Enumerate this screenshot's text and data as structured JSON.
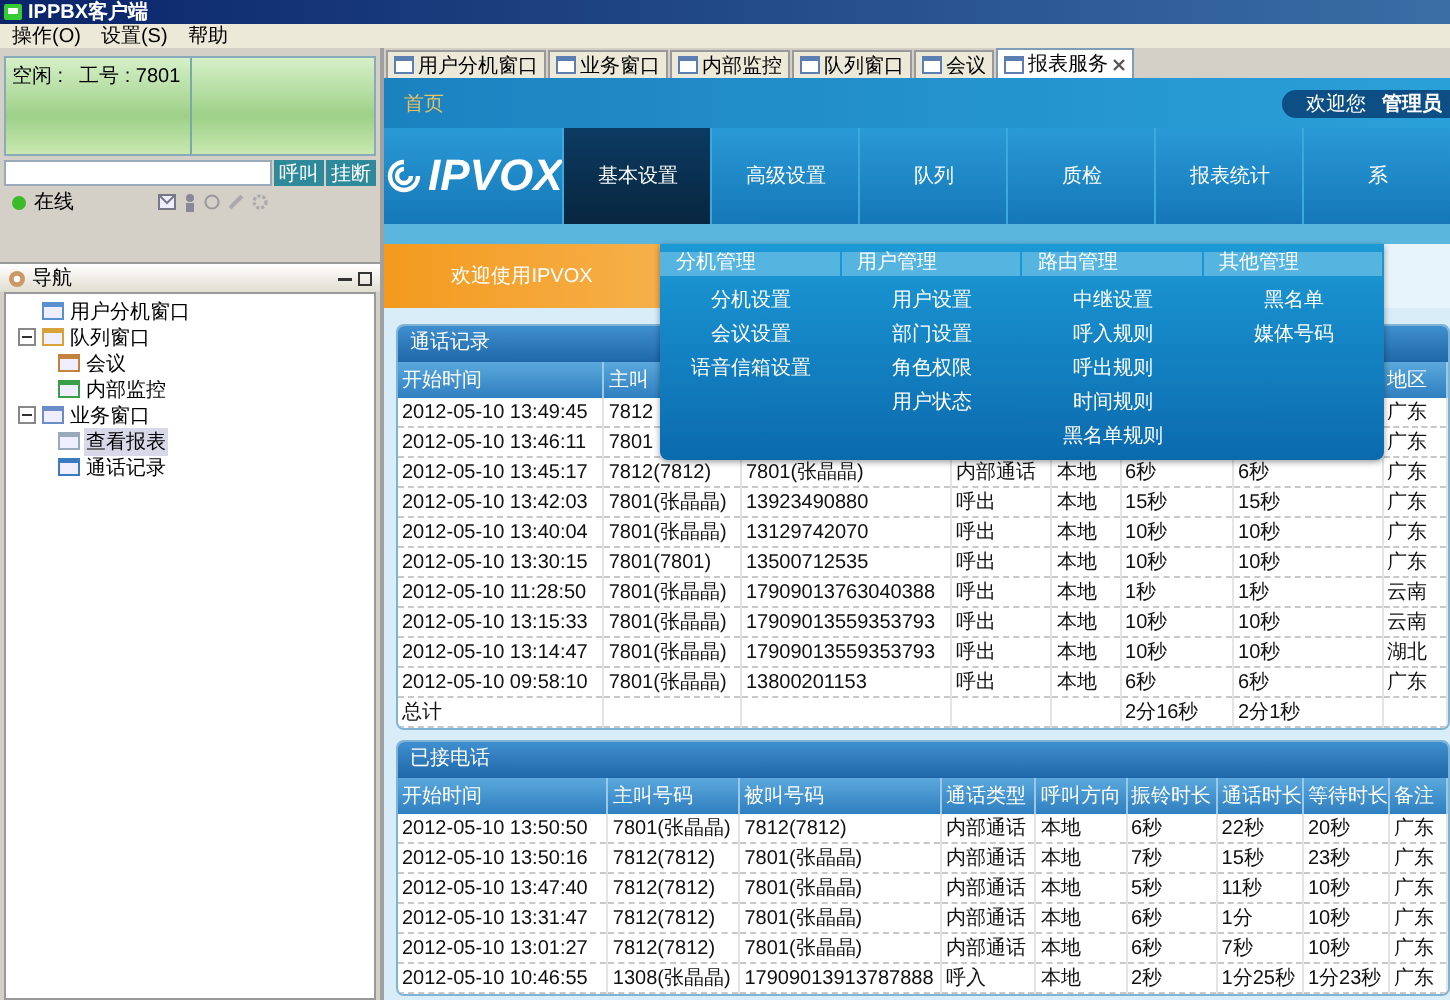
{
  "window": {
    "title": "IPPBX客户端"
  },
  "menu": [
    {
      "label": "操作(O)"
    },
    {
      "label": "设置(S)"
    },
    {
      "label": "帮助"
    }
  ],
  "agent_panel": {
    "status": "空闲 :",
    "extension": "工号 : 7801",
    "buttons": [
      "呼叫",
      "挂断"
    ],
    "presence": {
      "label": "在线",
      "online": true
    }
  },
  "navigator": {
    "title": "导航",
    "items": [
      {
        "label": "用户分机窗口",
        "selected": false
      },
      {
        "label": "队列窗口",
        "selected": false,
        "expanded": true,
        "children": [
          {
            "label": "会议",
            "selected": false
          },
          {
            "label": "内部监控",
            "selected": false
          }
        ]
      },
      {
        "label": "业务窗口",
        "selected": false,
        "expanded": true,
        "children": [
          {
            "label": "查看报表",
            "selected": true
          },
          {
            "label": "通话记录",
            "selected": false
          }
        ]
      }
    ]
  },
  "tabs": [
    {
      "label": "用户分机窗口",
      "selected": false
    },
    {
      "label": "业务窗口",
      "selected": false
    },
    {
      "label": "内部监控",
      "selected": false
    },
    {
      "label": "队列窗口",
      "selected": false
    },
    {
      "label": "会议",
      "selected": false
    },
    {
      "label": "报表服务",
      "selected": true,
      "closable": true
    }
  ],
  "web": {
    "home_link": "首页",
    "welcome": "欢迎您",
    "user": "管理员",
    "logo": "IPVOX",
    "nav": [
      {
        "label": "基本设置",
        "selected": true
      },
      {
        "label": "高级设置",
        "selected": false
      },
      {
        "label": "队列",
        "selected": false
      },
      {
        "label": "质检",
        "selected": false
      },
      {
        "label": "报表统计",
        "selected": false
      },
      {
        "label": "系",
        "selected": false
      }
    ],
    "banner": "欢迎使用IPVOX",
    "menu_groups": [
      {
        "title": "分机管理",
        "items": [
          "分机设置",
          "会议设置",
          "语音信箱设置"
        ]
      },
      {
        "title": "用户管理",
        "items": [
          "用户设置",
          "部门设置",
          "角色权限",
          "用户状态"
        ]
      },
      {
        "title": "路由管理",
        "items": [
          "中继设置",
          "呼入规则",
          "呼出规则",
          "时间规则",
          "黑名单规则"
        ]
      },
      {
        "title": "其他管理",
        "items": [
          "黑名单",
          "媒体号码"
        ]
      }
    ]
  },
  "calls_table": {
    "title": "通话记录",
    "columns": [
      "开始时间",
      "主叫",
      null,
      null,
      null,
      null,
      null,
      "地区"
    ],
    "rows": [
      [
        "2012-05-10 13:49:45",
        "7812",
        null,
        null,
        null,
        null,
        null,
        "广东"
      ],
      [
        "2012-05-10 13:46:11",
        "7801",
        null,
        null,
        null,
        null,
        null,
        "广东"
      ],
      [
        "2012-05-10 13:45:17",
        "7812(7812)",
        "7801(张晶晶)",
        "内部通话",
        "本地",
        "6秒",
        "6秒",
        "广东"
      ],
      [
        "2012-05-10 13:42:03",
        "7801(张晶晶)",
        "13923490880",
        "呼出",
        "本地",
        "15秒",
        "15秒",
        "广东"
      ],
      [
        "2012-05-10 13:40:04",
        "7801(张晶晶)",
        "13129742070",
        "呼出",
        "本地",
        "10秒",
        "10秒",
        "广东"
      ],
      [
        "2012-05-10 13:30:15",
        "7801(7801)",
        "13500712535",
        "呼出",
        "本地",
        "10秒",
        "10秒",
        "广东"
      ],
      [
        "2012-05-10 11:28:50",
        "7801(张晶晶)",
        "17909013763040388",
        "呼出",
        "本地",
        "1秒",
        "1秒",
        "云南"
      ],
      [
        "2012-05-10 13:15:33",
        "7801(张晶晶)",
        "17909013559353793",
        "呼出",
        "本地",
        "10秒",
        "10秒",
        "云南"
      ],
      [
        "2012-05-10 13:14:47",
        "7801(张晶晶)",
        "17909013559353793",
        "呼出",
        "本地",
        "10秒",
        "10秒",
        "湖北"
      ],
      [
        "2012-05-10 09:58:10",
        "7801(张晶晶)",
        "13800201153",
        "呼出",
        "本地",
        "6秒",
        "6秒",
        "广东"
      ]
    ],
    "total": {
      "label": "总计",
      "ring_duration": "2分16秒",
      "talk_duration": "2分1秒"
    }
  },
  "answered_table": {
    "title": "已接电话",
    "columns": [
      "开始时间",
      "主叫号码",
      "被叫号码",
      "通话类型",
      "呼叫方向",
      "振铃时长",
      "通话时长",
      "等待时长",
      "备注"
    ],
    "rows": [
      [
        "2012-05-10 13:50:50",
        "7801(张晶晶)",
        "7812(7812)",
        "内部通话",
        "本地",
        "6秒",
        "22秒",
        "20秒",
        "广东"
      ],
      [
        "2012-05-10 13:50:16",
        "7812(7812)",
        "7801(张晶晶)",
        "内部通话",
        "本地",
        "7秒",
        "15秒",
        "23秒",
        "广东"
      ],
      [
        "2012-05-10 13:47:40",
        "7812(7812)",
        "7801(张晶晶)",
        "内部通话",
        "本地",
        "5秒",
        "11秒",
        "10秒",
        "广东"
      ],
      [
        "2012-05-10 13:31:47",
        "7812(7812)",
        "7801(张晶晶)",
        "内部通话",
        "本地",
        "6秒",
        "1分",
        "10秒",
        "广东"
      ],
      [
        "2012-05-10 13:01:27",
        "7812(7812)",
        "7801(张晶晶)",
        "内部通话",
        "本地",
        "6秒",
        "7秒",
        "10秒",
        "广东"
      ],
      [
        "2012-05-10 10:46:55",
        "1308(张晶晶)",
        "17909013913787888",
        "呼入",
        "本地",
        "2秒",
        "1分25秒",
        "1分23秒",
        "广东"
      ]
    ]
  }
}
